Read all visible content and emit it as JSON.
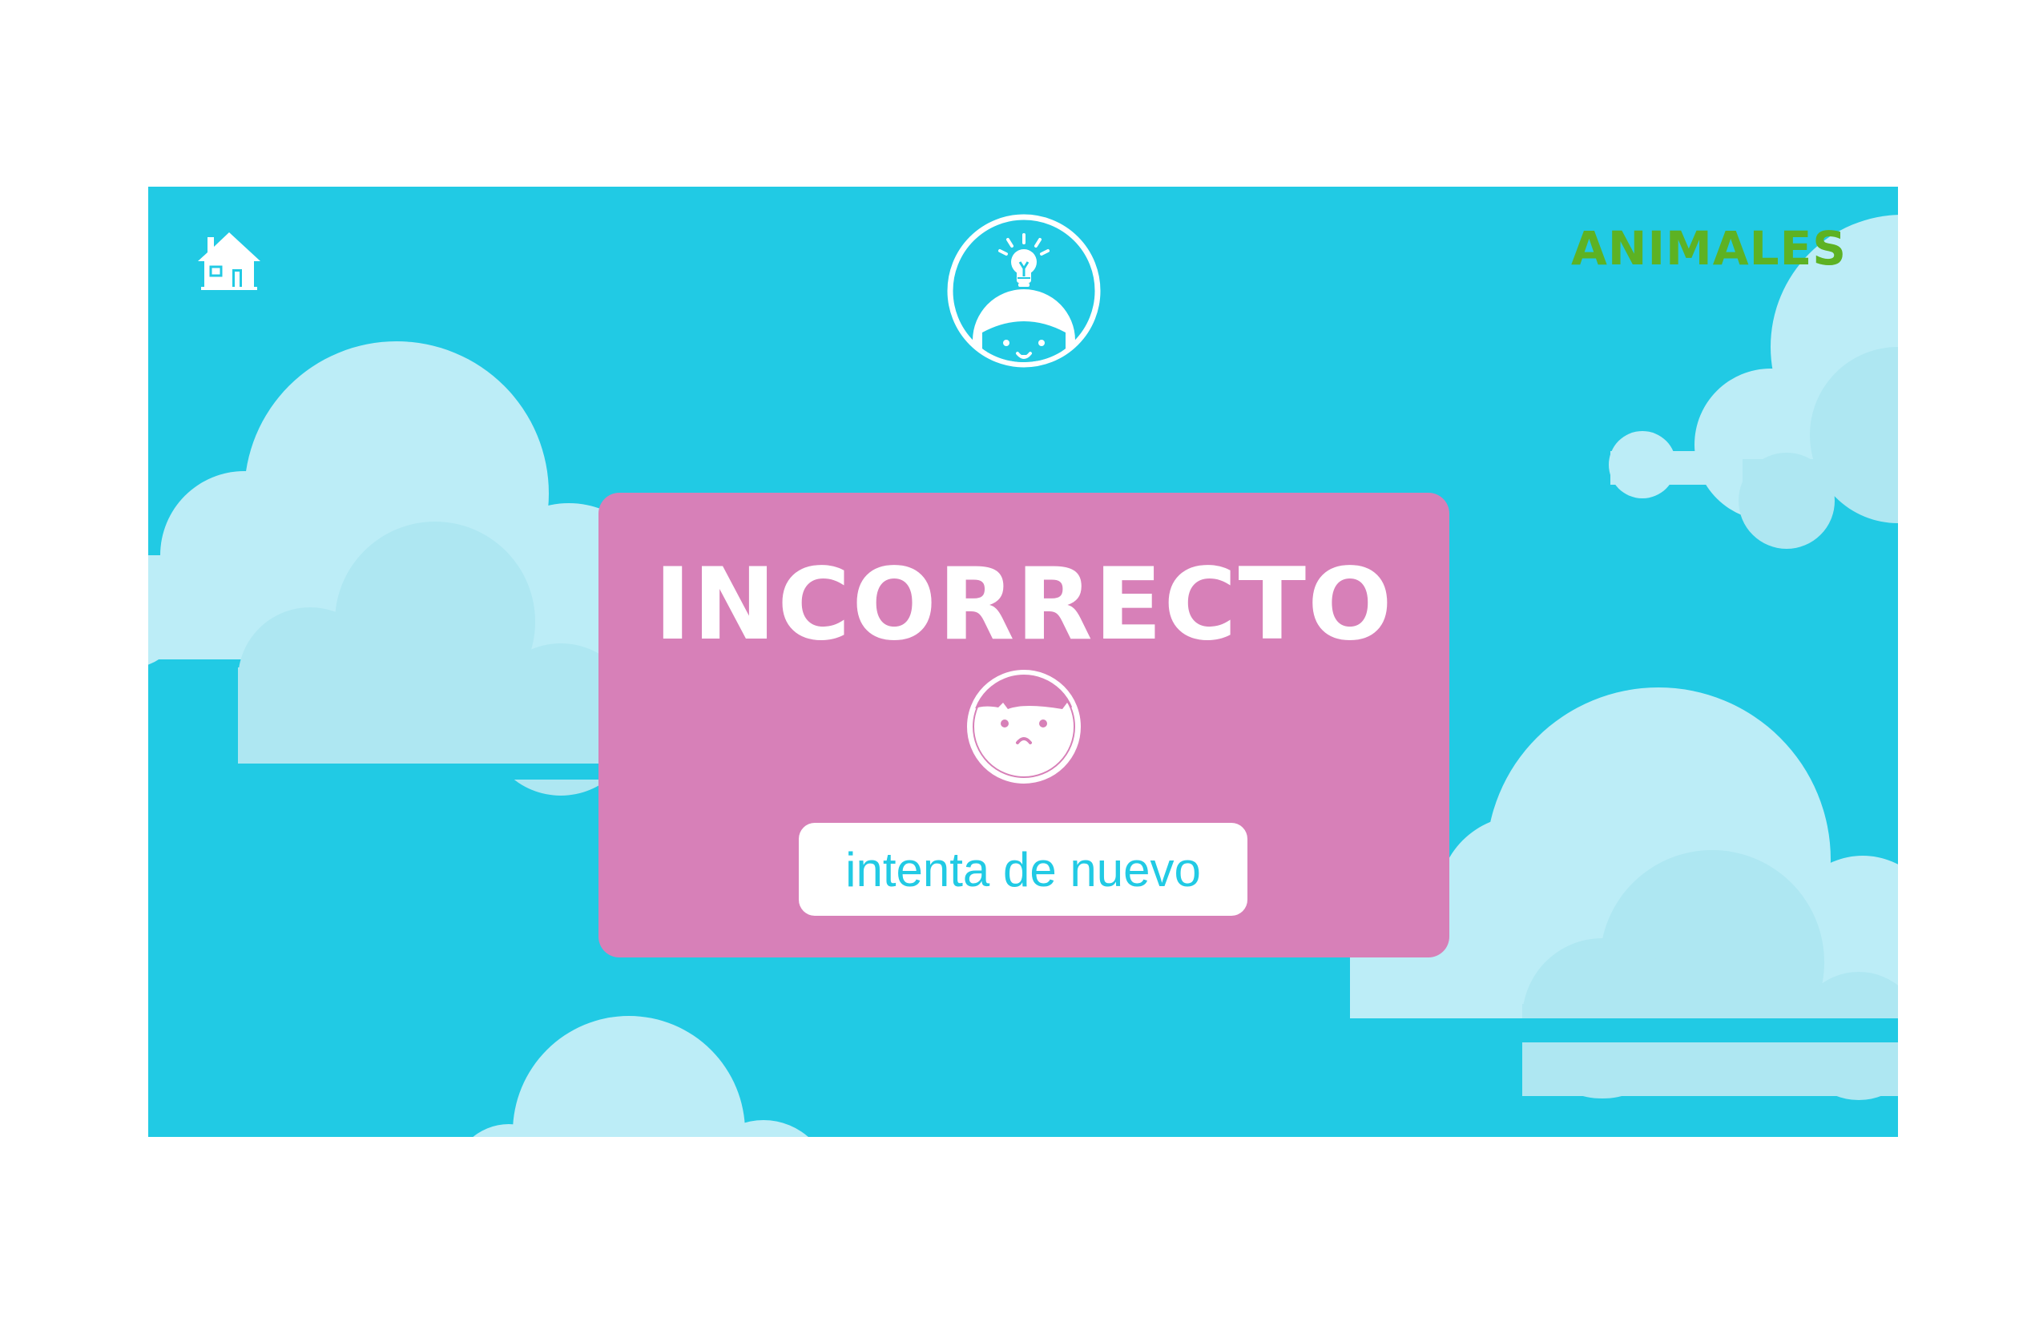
{
  "header": {
    "home_icon": "home-icon",
    "avatar_icon": "thinking-child-lightbulb-icon",
    "category": "ANIMALES"
  },
  "result": {
    "title": "INCORRECTO",
    "face_icon": "sad-face-icon",
    "retry_label": "intenta de nuevo"
  },
  "colors": {
    "background": "#ffffff",
    "sky": "#21cae4",
    "cloud_light": "#bcedf7",
    "cloud_shade": "#aee7f2",
    "panel": "#d780b8",
    "category_text": "#5db223",
    "button_text": "#21cae4"
  }
}
